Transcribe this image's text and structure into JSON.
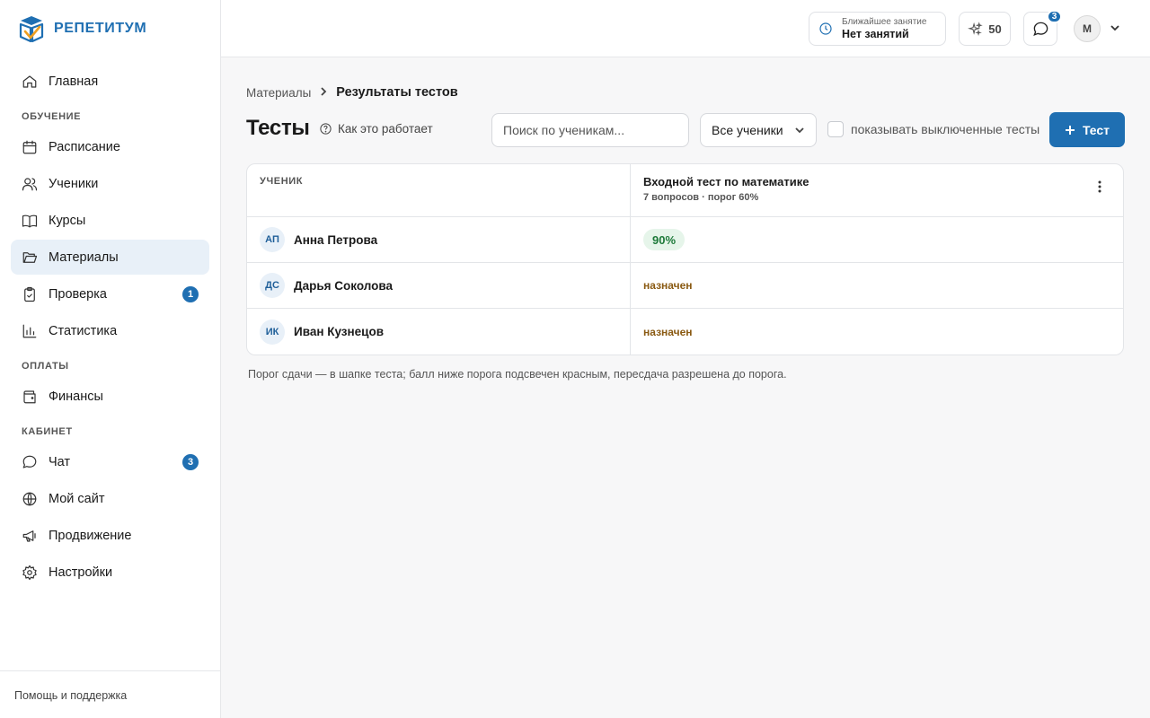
{
  "brand": {
    "name": "РЕПЕТИТУМ"
  },
  "sidebar": {
    "items": [
      {
        "label": "Главная",
        "icon": "home-icon"
      },
      {
        "section": "ОБУЧЕНИЕ"
      },
      {
        "label": "Расписание",
        "icon": "calendar-icon"
      },
      {
        "label": "Ученики",
        "icon": "users-icon"
      },
      {
        "label": "Курсы",
        "icon": "book-icon"
      },
      {
        "label": "Материалы",
        "icon": "folder-icon",
        "active": true
      },
      {
        "label": "Проверка",
        "icon": "clipboard-icon",
        "badge": "1"
      },
      {
        "label": "Статистика",
        "icon": "chart-icon"
      },
      {
        "section": "ОПЛАТЫ"
      },
      {
        "label": "Финансы",
        "icon": "wallet-icon"
      },
      {
        "section": "КАБИНЕТ"
      },
      {
        "label": "Чат",
        "icon": "chat-icon",
        "badge": "3"
      },
      {
        "label": "Мой сайт",
        "icon": "globe-icon"
      },
      {
        "label": "Продвижение",
        "icon": "megaphone-icon"
      },
      {
        "label": "Настройки",
        "icon": "gear-icon"
      }
    ],
    "footer": "Помощь и поддержка"
  },
  "header": {
    "next_lesson_label": "Ближайшее занятие",
    "next_lesson_value": "Нет занятий",
    "points": "50",
    "chat_badge": "3",
    "avatar_initial": "М"
  },
  "breadcrumb": {
    "parent": "Материалы",
    "current": "Результаты тестов"
  },
  "page": {
    "title": "Тесты",
    "how_it_works": "Как это работает",
    "search_placeholder": "Поиск по ученикам...",
    "filter_value": "Все ученики",
    "show_disabled_label": "показывать выключенные тесты",
    "add_button": "Тест"
  },
  "table": {
    "student_header": "УЧЕНИК",
    "test_title": "Входной тест по математике",
    "test_meta": "7 вопросов · порог 60%",
    "rows": [
      {
        "initials": "АП",
        "name": "Анна Петрова",
        "result": "90%",
        "status": "score"
      },
      {
        "initials": "ДС",
        "name": "Дарья Соколова",
        "result": "назначен",
        "status": "assigned"
      },
      {
        "initials": "ИК",
        "name": "Иван Кузнецов",
        "result": "назначен",
        "status": "assigned"
      }
    ]
  },
  "note": "Порог сдачи — в шапке теста; балл ниже порога подсвечен красным, пересдача разрешена до порога.",
  "colors": {
    "accent": "#1f6fb2",
    "score_bg": "#e6f5ea",
    "score_text": "#1e7a3a",
    "assigned_text": "#8a5a12"
  }
}
